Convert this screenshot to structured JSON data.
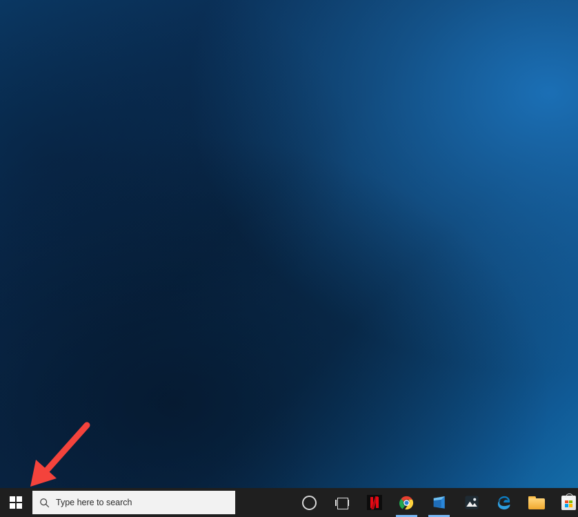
{
  "desktop": {
    "wallpaper_colors": {
      "top_right": "#1571ad",
      "mid": "#0a2f56",
      "bottom_left": "#081f3a"
    }
  },
  "annotation": {
    "arrow": {
      "color": "#f4433c",
      "points_to": "start-button",
      "label": "red-arrow-pointing-to-start-button"
    }
  },
  "taskbar": {
    "background": "#1f1f1f",
    "start_button": {
      "name": "Start",
      "icon": "windows-logo-icon"
    },
    "search": {
      "placeholder": "Type here to search",
      "value": "Type here to search",
      "icon": "search-icon",
      "background": "#f2f2f2"
    },
    "items": [
      {
        "label": "Cortana",
        "icon": "cortana-circle-icon",
        "active": false
      },
      {
        "label": "Task View",
        "icon": "task-view-icon",
        "active": false
      },
      {
        "label": "Netflix",
        "icon": "netflix-icon",
        "active": false
      },
      {
        "label": "Google Chrome",
        "icon": "chrome-icon",
        "active": true
      },
      {
        "label": "Microsoft Store Preview",
        "icon": "blue-app-icon",
        "active": true
      },
      {
        "label": "Photos",
        "icon": "photos-icon",
        "active": false
      },
      {
        "label": "Microsoft Edge",
        "icon": "edge-icon",
        "active": false
      },
      {
        "label": "File Explorer",
        "icon": "folder-icon",
        "active": false
      },
      {
        "label": "Microsoft Store",
        "icon": "store-icon",
        "active": false
      }
    ]
  }
}
